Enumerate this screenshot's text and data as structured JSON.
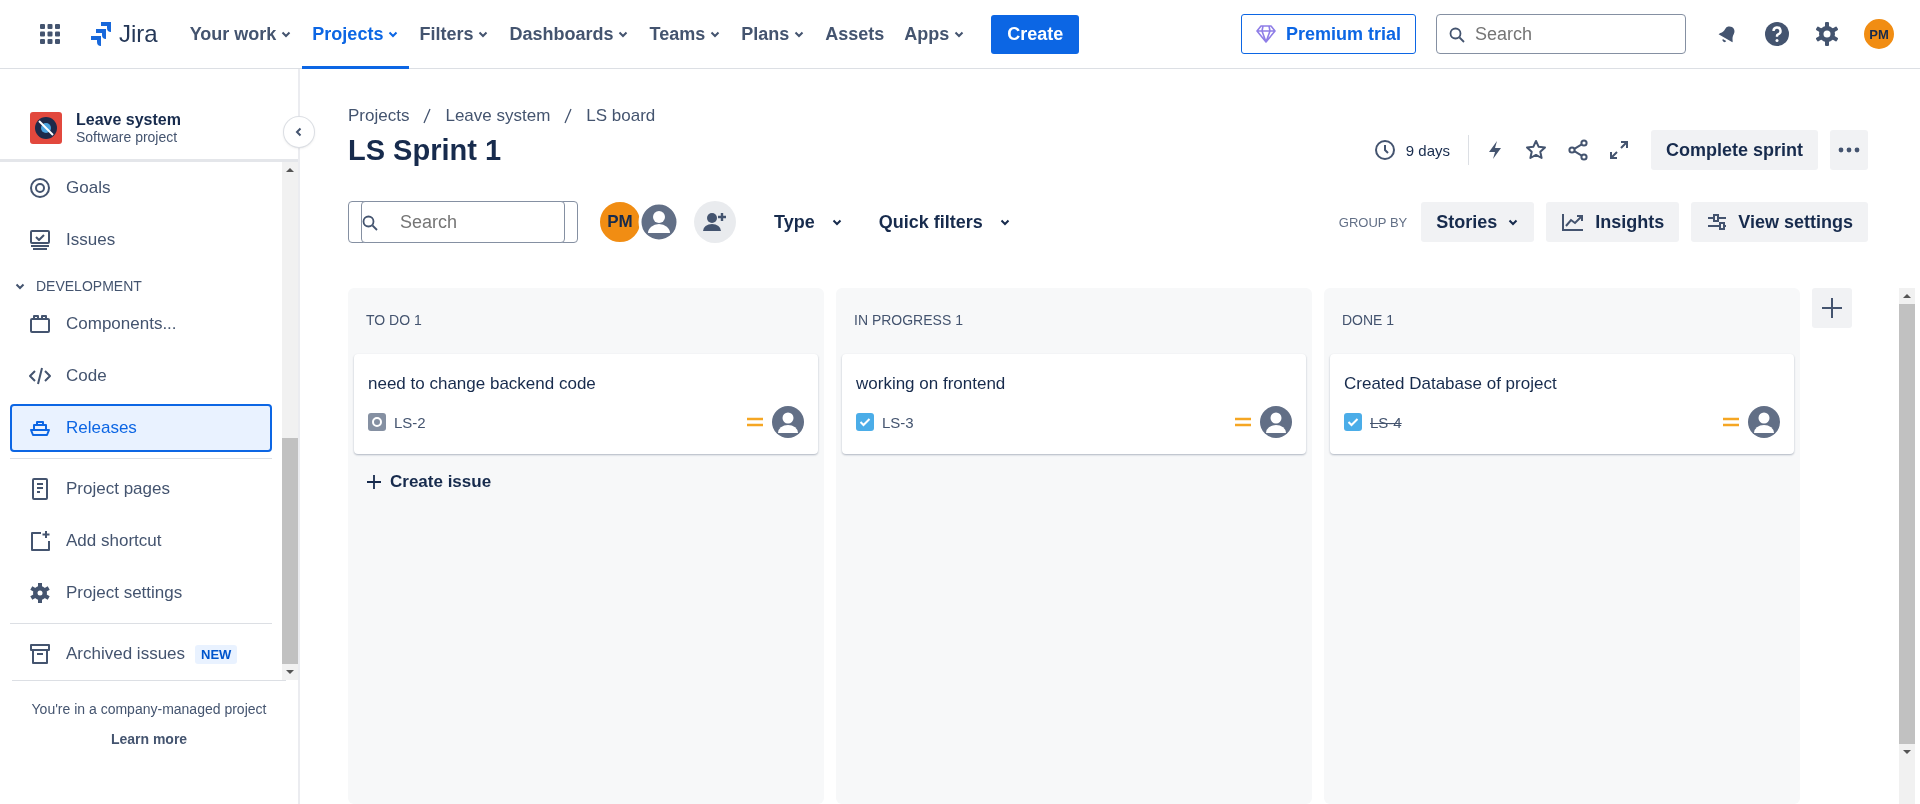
{
  "topbar": {
    "logo": "Jira",
    "nav": [
      {
        "label": "Your work",
        "dropdown": true,
        "selected": false
      },
      {
        "label": "Projects",
        "dropdown": true,
        "selected": true
      },
      {
        "label": "Filters",
        "dropdown": true,
        "selected": false
      },
      {
        "label": "Dashboards",
        "dropdown": true,
        "selected": false
      },
      {
        "label": "Teams",
        "dropdown": true,
        "selected": false
      },
      {
        "label": "Plans",
        "dropdown": true,
        "selected": false
      },
      {
        "label": "Assets",
        "dropdown": false,
        "selected": false
      },
      {
        "label": "Apps",
        "dropdown": true,
        "selected": false
      }
    ],
    "create": "Create",
    "premium": "Premium trial",
    "search": {
      "placeholder": "Search"
    },
    "avatar": "PM"
  },
  "sidebar": {
    "project": {
      "name": "Leave system",
      "type": "Software project"
    },
    "groups": [
      {
        "items": [
          {
            "label": "Goals",
            "kind": "goals",
            "selected": false
          },
          {
            "label": "Issues",
            "kind": "issues",
            "selected": false
          }
        ]
      },
      {
        "heading": "DEVELOPMENT",
        "expanded": true,
        "items": [
          {
            "label": "Components...",
            "kind": "components",
            "selected": false
          },
          {
            "label": "Code",
            "kind": "code",
            "selected": false
          },
          {
            "label": "Releases",
            "kind": "releases",
            "selected": true
          }
        ]
      },
      {
        "items": [
          {
            "label": "Project pages",
            "kind": "pages",
            "selected": false
          },
          {
            "label": "Add shortcut",
            "kind": "shortcut",
            "selected": false
          },
          {
            "label": "Project settings",
            "kind": "settings",
            "selected": false
          }
        ]
      },
      {
        "items": [
          {
            "label": "Archived issues",
            "kind": "archive",
            "badge": "NEW",
            "selected": false
          }
        ]
      }
    ],
    "footer": {
      "note": "You're in a company-managed project",
      "link": "Learn more"
    }
  },
  "board": {
    "breadcrumbs": [
      "Projects",
      "Leave system",
      "LS board"
    ],
    "title": "LS Sprint 1",
    "days": "9 days",
    "complete": "Complete sprint",
    "search": {
      "placeholder": "Search"
    },
    "people": [
      "PM"
    ],
    "filters": [
      "Type",
      "Quick filters"
    ],
    "group_by": {
      "label": "GROUP BY",
      "value": "Stories"
    },
    "insights": "Insights",
    "view_settings": "View settings",
    "columns": [
      {
        "title": "TO DO 1",
        "create": "Create issue",
        "cards": [
          {
            "summary": "need to change backend code",
            "key": "LS-2",
            "kind": "subtask",
            "done": false
          }
        ]
      },
      {
        "title": "IN PROGRESS 1",
        "cards": [
          {
            "summary": "working on frontend",
            "key": "LS-3",
            "kind": "task",
            "done": false
          }
        ]
      },
      {
        "title": "DONE 1",
        "cards": [
          {
            "summary": "Created Database of project",
            "key": "LS-4",
            "kind": "task",
            "done": true
          }
        ]
      }
    ]
  }
}
